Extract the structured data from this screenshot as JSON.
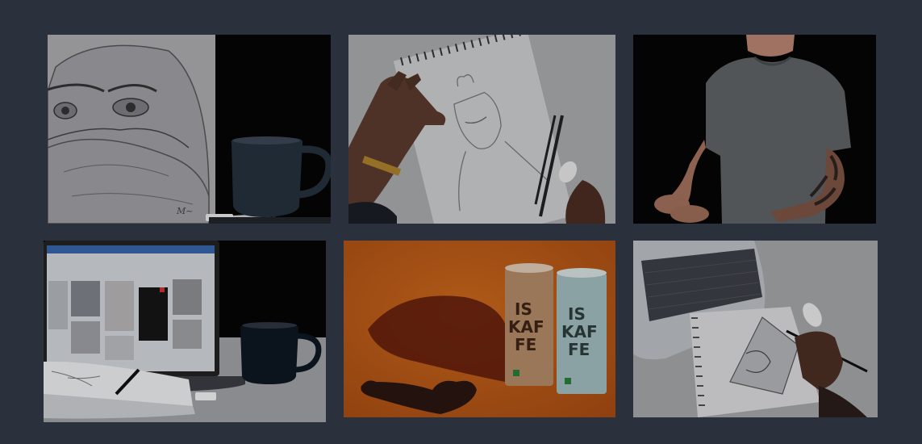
{
  "gallery": {
    "tiles": [
      {
        "icon": "hijab-sketch-with-mug-image"
      },
      {
        "icon": "hand-drawing-sketchbook-image"
      },
      {
        "icon": "man-grey-tshirt-tattoo-image"
      },
      {
        "icon": "laptop-pinterest-sketchbook-image"
      },
      {
        "icon": "iskaffe-cans-coffee-heart-image"
      },
      {
        "icon": "laptop-sketch-drawing-image"
      }
    ],
    "can_text_lines": [
      "IS",
      "KAF",
      "FE"
    ]
  }
}
